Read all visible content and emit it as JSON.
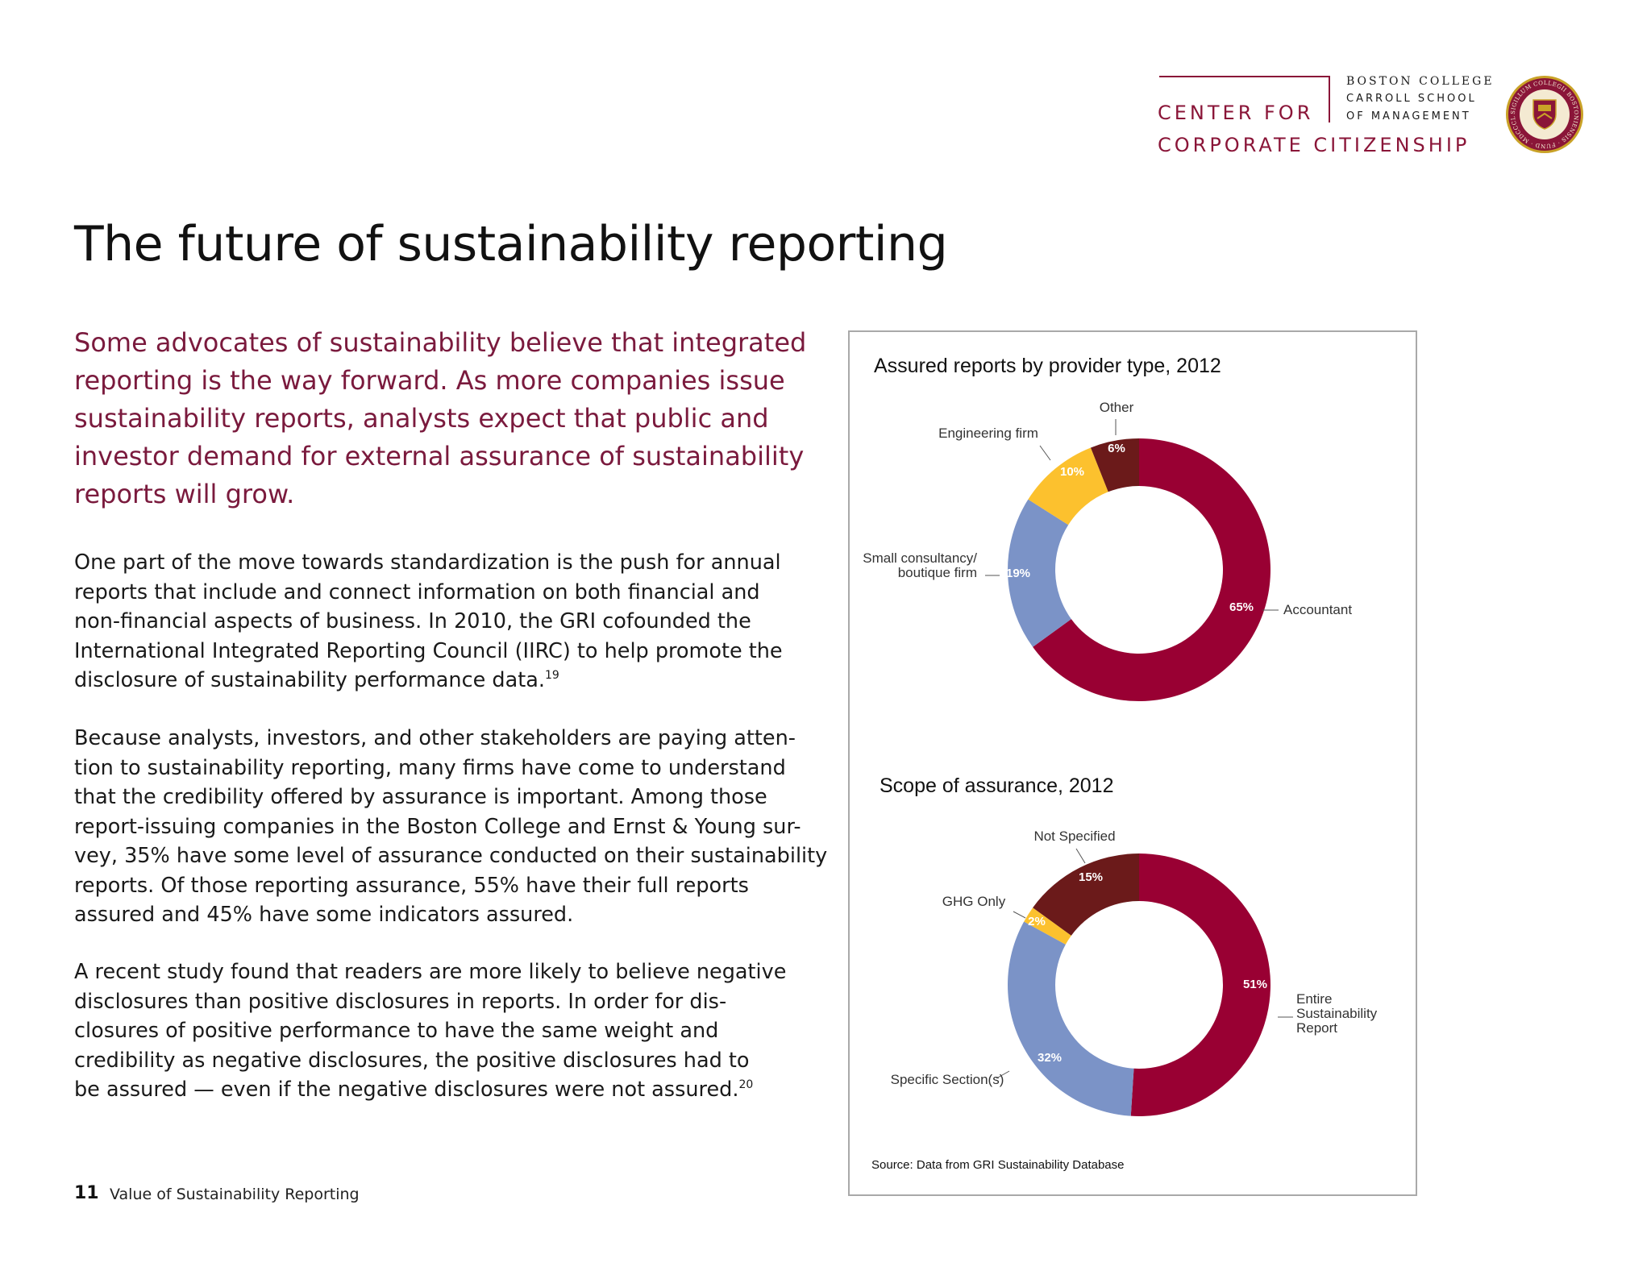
{
  "header": {
    "center_line1": "CENTER FOR",
    "center_line2": "CORPORATE CITIZENSHIP",
    "school_line1": "BOSTON COLLEGE",
    "school_line2": "CARROLL SCHOOL",
    "school_line3": "OF MANAGEMENT",
    "seal_text": "SIGILLUM COLLEGII BOSTONIENSIS · FUND · MDCCCLXIII",
    "accent_color": "#8a1538"
  },
  "title": "The future of sustainability reporting",
  "lead_lines": [
    "Some advocates of sustainability believe that integrated",
    "reporting is the way forward. As more companies issue",
    "sustainability reports, analysts expect that public and",
    "investor demand for external assurance of sustainability",
    "reports will grow."
  ],
  "paragraphs": [
    {
      "lines": [
        "One part of the move towards standardization is the push for annual",
        "reports that include and connect information on both financial and",
        "non-financial aspects of business. In 2010, the GRI cofounded the",
        "International Integrated Reporting Council (IIRC) to help promote the",
        "disclosure of sustainability performance data."
      ],
      "footnote": "19"
    },
    {
      "lines": [
        "Because analysts, investors, and other stakeholders are paying atten-",
        "tion to sustainability reporting, many firms have come to understand",
        "that the credibility offered by assurance is important. Among those",
        "report-issuing companies in the Boston College and Ernst & Young sur-",
        "vey, 35% have some level of assurance conducted on their sustainability",
        "reports. Of those reporting assurance, 55% have their full reports",
        "assured and 45% have some indicators assured."
      ],
      "footnote": ""
    },
    {
      "lines": [
        "A recent study found that readers are more likely to believe negative",
        "disclosures than positive disclosures in reports. In order for dis-",
        "closures of positive performance to have the same weight and",
        "credibility as negative disclosures, the positive disclosures had to",
        "be assured — even if the negative disclosures were not assured."
      ],
      "footnote": "20"
    }
  ],
  "footer": {
    "page_number": "11",
    "page_label": "Value of Sustainability Reporting"
  },
  "chart_source": "Source: Data from GRI Sustainability Database",
  "chart_data": [
    {
      "type": "pie",
      "donut": true,
      "title": "Assured reports by provider type, 2012",
      "slices": [
        {
          "label": "Accountant",
          "value": 65,
          "value_label": "65%",
          "color": "#990033"
        },
        {
          "label": "Small consultancy/ boutique firm",
          "label_lines": [
            "Small consultancy/",
            "boutique firm"
          ],
          "value": 19,
          "value_label": "19%",
          "color": "#7b93c7"
        },
        {
          "label": "Engineering firm",
          "value": 10,
          "value_label": "10%",
          "color": "#fcc12e"
        },
        {
          "label": "Other",
          "value": 6,
          "value_label": "6%",
          "color": "#6b1a1a"
        }
      ]
    },
    {
      "type": "pie",
      "donut": true,
      "title": "Scope of assurance, 2012",
      "slices": [
        {
          "label": "Entire Sustainability Report",
          "label_lines": [
            "Entire",
            "Sustainability",
            "Report"
          ],
          "value": 51,
          "value_label": "51%",
          "color": "#990033"
        },
        {
          "label": "Specific Section(s)",
          "value": 32,
          "value_label": "32%",
          "color": "#7b93c7"
        },
        {
          "label": "GHG Only",
          "value": 2,
          "value_label": "2%",
          "color": "#fcc12e"
        },
        {
          "label": "Not Specified",
          "value": 15,
          "value_label": "15%",
          "color": "#6b1a1a"
        }
      ]
    }
  ]
}
